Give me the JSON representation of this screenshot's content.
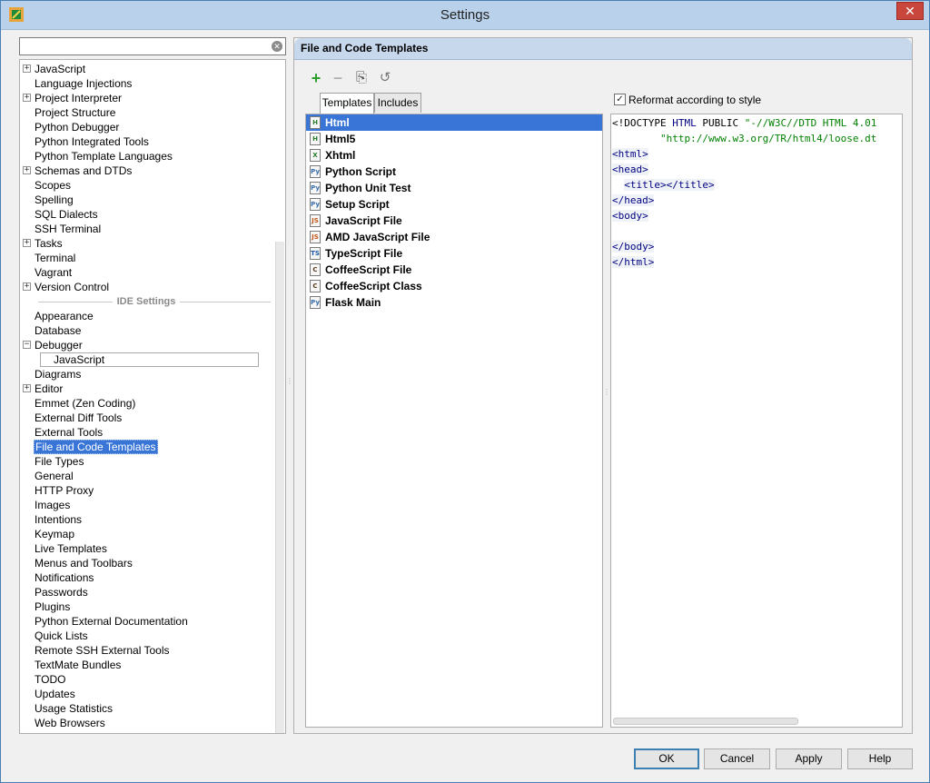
{
  "window": {
    "title": "Settings",
    "close_label": "✕"
  },
  "search": {
    "value": "",
    "clear_label": "✕"
  },
  "tree": {
    "items": [
      {
        "label": "JavaScript",
        "expander": "+"
      },
      {
        "label": "Language Injections"
      },
      {
        "label": "Project Interpreter",
        "expander": "+"
      },
      {
        "label": "Project Structure"
      },
      {
        "label": "Python Debugger"
      },
      {
        "label": "Python Integrated Tools"
      },
      {
        "label": "Python Template Languages"
      },
      {
        "label": "Schemas and DTDs",
        "expander": "+"
      },
      {
        "label": "Scopes"
      },
      {
        "label": "Spelling"
      },
      {
        "label": "SQL Dialects"
      },
      {
        "label": "SSH Terminal"
      },
      {
        "label": "Tasks",
        "expander": "+"
      },
      {
        "label": "Terminal"
      },
      {
        "label": "Vagrant"
      },
      {
        "label": "Version Control",
        "expander": "+"
      }
    ],
    "section_label": "IDE Settings",
    "ide_items": [
      {
        "label": "Appearance"
      },
      {
        "label": "Database"
      },
      {
        "label": "Debugger",
        "expander": "−"
      },
      {
        "label": "JavaScript",
        "child": true
      },
      {
        "label": "Diagrams"
      },
      {
        "label": "Editor",
        "expander": "+"
      },
      {
        "label": "Emmet (Zen Coding)"
      },
      {
        "label": "External Diff Tools"
      },
      {
        "label": "External Tools"
      },
      {
        "label": "File and Code Templates",
        "selected": true
      },
      {
        "label": "File Types"
      },
      {
        "label": "General"
      },
      {
        "label": "HTTP Proxy"
      },
      {
        "label": "Images"
      },
      {
        "label": "Intentions"
      },
      {
        "label": "Keymap"
      },
      {
        "label": "Live Templates"
      },
      {
        "label": "Menus and Toolbars"
      },
      {
        "label": "Notifications"
      },
      {
        "label": "Passwords"
      },
      {
        "label": "Plugins"
      },
      {
        "label": "Python External Documentation"
      },
      {
        "label": "Quick Lists"
      },
      {
        "label": "Remote SSH External Tools"
      },
      {
        "label": "TextMate Bundles"
      },
      {
        "label": "TODO"
      },
      {
        "label": "Updates"
      },
      {
        "label": "Usage Statistics"
      },
      {
        "label": "Web Browsers"
      }
    ]
  },
  "panel": {
    "title": "File and Code Templates",
    "toolbar": {
      "add": "+",
      "remove": "−",
      "copy": "⎘",
      "reset": "↺"
    },
    "tabs": [
      {
        "label": "Templates",
        "active": true
      },
      {
        "label": "Includes"
      }
    ],
    "templates": [
      {
        "label": "Html",
        "icon": "H",
        "color": "#2a7a2a",
        "selected": true
      },
      {
        "label": "Html5",
        "icon": "H",
        "color": "#2a7a2a"
      },
      {
        "label": "Xhtml",
        "icon": "X",
        "color": "#2a7a2a"
      },
      {
        "label": "Python Script",
        "icon": "Py",
        "color": "#3a6fb0"
      },
      {
        "label": "Python Unit Test",
        "icon": "Py",
        "color": "#3a6fb0"
      },
      {
        "label": "Setup Script",
        "icon": "Py",
        "color": "#3a6fb0"
      },
      {
        "label": "JavaScript File",
        "icon": "JS",
        "color": "#c0561a"
      },
      {
        "label": "AMD JavaScript File",
        "icon": "JS",
        "color": "#c0561a"
      },
      {
        "label": "TypeScript File",
        "icon": "TS",
        "color": "#1a5aa8"
      },
      {
        "label": "CoffeeScript File",
        "icon": "C",
        "color": "#5a3a1a"
      },
      {
        "label": "CoffeeScript Class",
        "icon": "C",
        "color": "#5a3a1a"
      },
      {
        "label": "Flask Main",
        "icon": "Py",
        "color": "#3a6fb0"
      }
    ],
    "reformat_label": "Reformat according to style",
    "reformat_checked": "✓",
    "code_lines": [
      [
        {
          "t": "<!DOCTYPE ",
          "c": ""
        },
        {
          "t": "HTML",
          "c": "c-kw"
        },
        {
          "t": " PUBLIC ",
          "c": ""
        },
        {
          "t": "\"-//W3C//DTD HTML 4.01",
          "c": "c-str"
        }
      ],
      [
        {
          "t": "        ",
          "c": ""
        },
        {
          "t": "\"http://www.w3.org/TR/html4/loose.dt",
          "c": "c-str"
        }
      ],
      [
        {
          "t": "<html>",
          "c": "c-tag"
        }
      ],
      [
        {
          "t": "<head>",
          "c": "c-tag"
        }
      ],
      [
        {
          "t": "  ",
          "c": ""
        },
        {
          "t": "<title></title>",
          "c": "c-tag"
        }
      ],
      [
        {
          "t": "</head>",
          "c": "c-tag"
        }
      ],
      [
        {
          "t": "<body>",
          "c": "c-tag"
        }
      ],
      [
        {
          "t": "",
          "c": ""
        }
      ],
      [
        {
          "t": "</body>",
          "c": "c-tag"
        }
      ],
      [
        {
          "t": "</html>",
          "c": "c-tag"
        }
      ]
    ]
  },
  "footer": {
    "ok": "OK",
    "cancel": "Cancel",
    "apply": "Apply",
    "help": "Help"
  }
}
